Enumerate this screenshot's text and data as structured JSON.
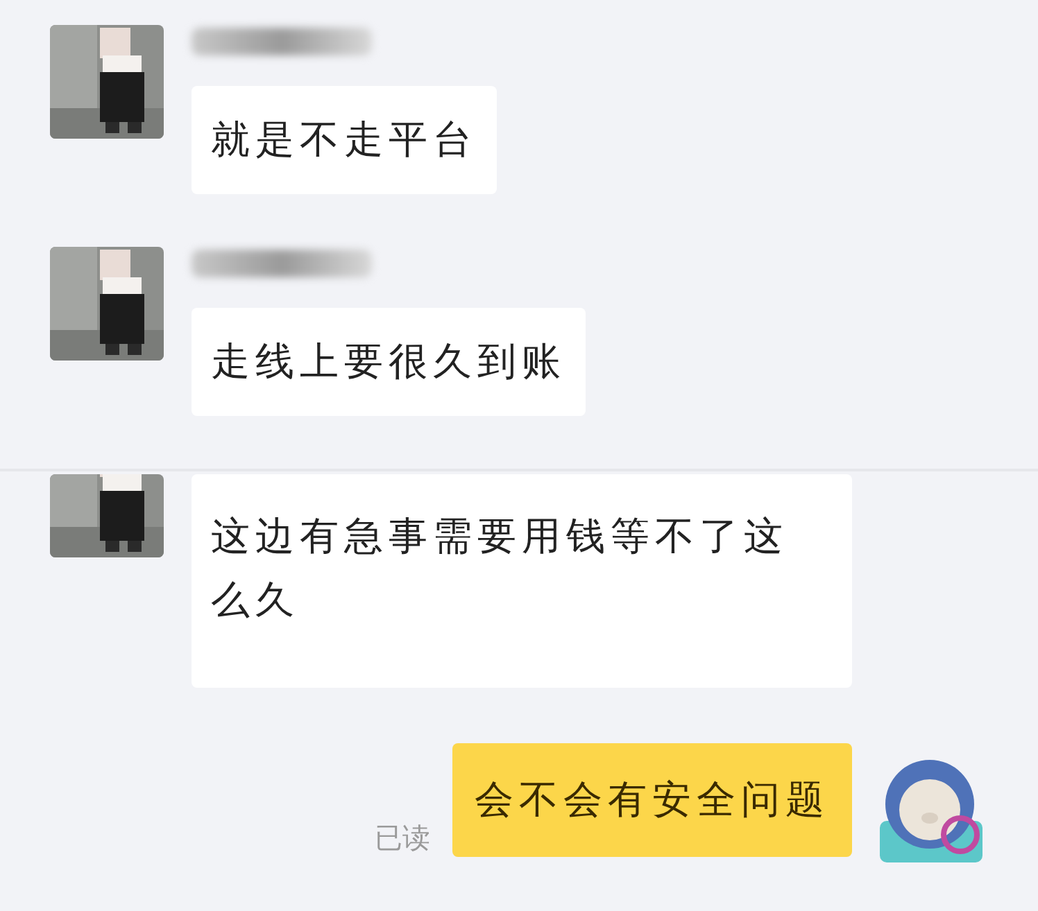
{
  "messages": [
    {
      "kind": "received",
      "name_redacted": true,
      "text": "就是不走平台"
    },
    {
      "kind": "received",
      "name_redacted": true,
      "text": "走线上要很久到账"
    },
    {
      "kind": "received",
      "name_redacted": false,
      "text": "这边有急事需要用钱等不了这么久"
    },
    {
      "kind": "sent",
      "status": "已读",
      "text": "会不会有安全问题"
    }
  ]
}
